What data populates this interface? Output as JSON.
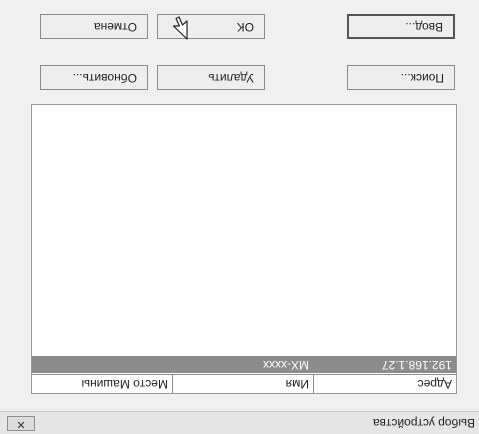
{
  "dialog": {
    "title": "Выбор устройства",
    "close_label": "✕"
  },
  "device_list": {
    "columns": [
      "Адрес",
      "Имя",
      "Место Машины"
    ],
    "rows": [
      {
        "address": "192.168.1.27",
        "name": "MX-xxxx",
        "location": ""
      }
    ]
  },
  "buttons": {
    "search": "Поиск...",
    "delete": "Удалить",
    "refresh": "Обновить...",
    "input": "Ввод...",
    "ok": "OK",
    "cancel": "Отмена"
  }
}
